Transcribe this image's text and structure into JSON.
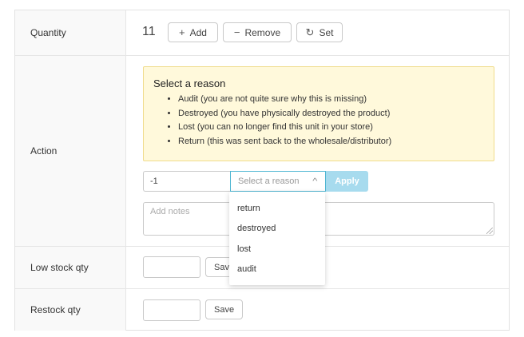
{
  "rows": {
    "quantity": {
      "label": "Quantity",
      "value": "11",
      "buttons": {
        "add": "Add",
        "remove": "Remove",
        "set": "Set"
      }
    },
    "action": {
      "label": "Action",
      "notice": {
        "title": "Select a reason",
        "items": [
          "Audit (you are not quite sure why this is missing)",
          "Destroyed (you have physically destroyed the product)",
          "Lost (you can no longer find this unit in your store)",
          "Return (this was sent back to the wholesale/distributor)"
        ]
      },
      "delta_value": "-1",
      "reason_placeholder": "Select a reason",
      "apply_label": "Apply",
      "notes_placeholder": "Add notes",
      "reason_options": [
        "return",
        "destroyed",
        "lost",
        "audit"
      ]
    },
    "low_stock": {
      "label": "Low stock qty",
      "save_label": "Save"
    },
    "restock": {
      "label": "Restock qty",
      "save_label": "Save"
    }
  },
  "icons": {
    "add": "plus-icon",
    "remove": "minus-icon",
    "set": "refresh-icon",
    "select": "chevron-up-icon"
  },
  "colors": {
    "notice_bg": "#fff9db",
    "notice_border": "#f0dc8c",
    "focus_border": "#4fb6d2",
    "apply_bg": "#a7dbee"
  }
}
